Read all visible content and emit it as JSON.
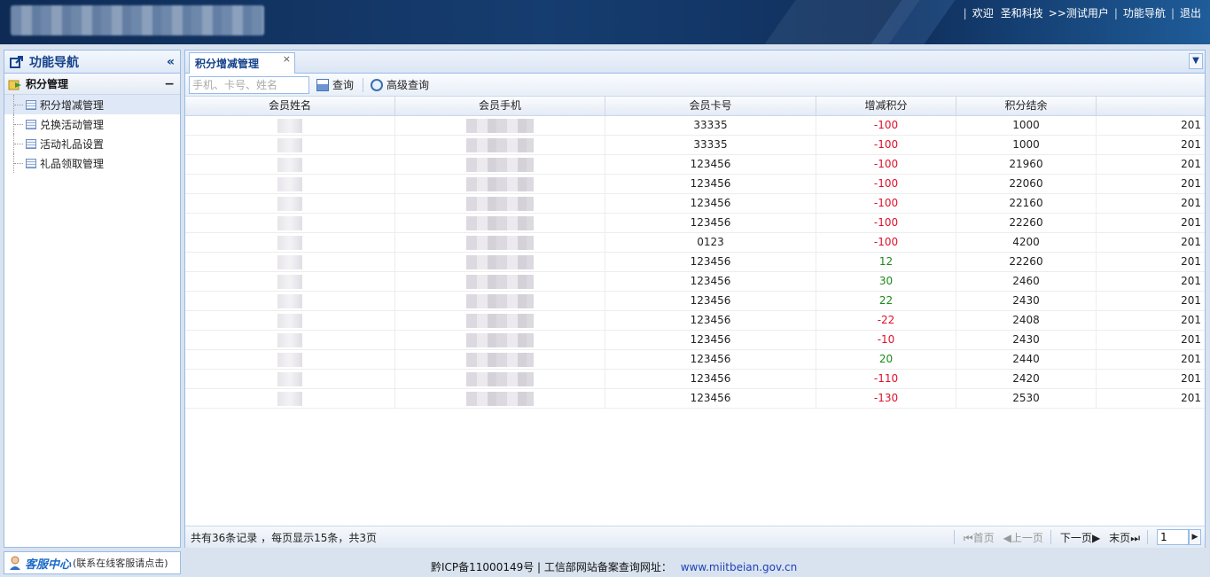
{
  "header": {
    "welcome": "欢迎",
    "company": "圣和科技",
    "user": ">>测试用户",
    "nav_link": "功能导航",
    "logout": "退出"
  },
  "sidebar": {
    "title": "功能导航",
    "group": "积分管理",
    "items": [
      {
        "label": "积分增减管理"
      },
      {
        "label": "兑换活动管理"
      },
      {
        "label": "活动礼品设置"
      },
      {
        "label": "礼品领取管理"
      }
    ]
  },
  "service": {
    "name": "客服中心",
    "hint": "(联系在线客服请点击)"
  },
  "tab": {
    "label": "积分增减管理",
    "close": "×"
  },
  "toolbar": {
    "search_placeholder": "手机、卡号、姓名",
    "query_label": "查询",
    "advanced_label": "高级查询"
  },
  "table": {
    "columns": [
      "会员姓名",
      "会员手机",
      "会员卡号",
      "增减积分",
      "积分结余",
      ""
    ],
    "rows": [
      {
        "card": "33335",
        "delta": "-100",
        "balance": "1000",
        "date": "201"
      },
      {
        "card": "33335",
        "delta": "-100",
        "balance": "1000",
        "date": "201"
      },
      {
        "card": "123456",
        "delta": "-100",
        "balance": "21960",
        "date": "201"
      },
      {
        "card": "123456",
        "delta": "-100",
        "balance": "22060",
        "date": "201"
      },
      {
        "card": "123456",
        "delta": "-100",
        "balance": "22160",
        "date": "201"
      },
      {
        "card": "123456",
        "delta": "-100",
        "balance": "22260",
        "date": "201"
      },
      {
        "card": "0123",
        "delta": "-100",
        "balance": "4200",
        "date": "201"
      },
      {
        "card": "123456",
        "delta": "12",
        "balance": "22260",
        "date": "201"
      },
      {
        "card": "123456",
        "delta": "30",
        "balance": "2460",
        "date": "201"
      },
      {
        "card": "123456",
        "delta": "22",
        "balance": "2430",
        "date": "201"
      },
      {
        "card": "123456",
        "delta": "-22",
        "balance": "2408",
        "date": "201"
      },
      {
        "card": "123456",
        "delta": "-10",
        "balance": "2430",
        "date": "201"
      },
      {
        "card": "123456",
        "delta": "20",
        "balance": "2440",
        "date": "201"
      },
      {
        "card": "123456",
        "delta": "-110",
        "balance": "2420",
        "date": "201"
      },
      {
        "card": "123456",
        "delta": "-130",
        "balance": "2530",
        "date": "201"
      }
    ]
  },
  "pager": {
    "summary": "共有36条记录 ，每页显示15条，共3页",
    "first": "首页",
    "prev": "上一页",
    "next": "下一页",
    "last": "末页",
    "page": "1"
  },
  "footer": {
    "icp": "黔ICP备11000149号 | 工信部网站备案查询网址：",
    "url": "www.miitbeian.gov.cn"
  },
  "colors": {
    "negative": "#e0102a",
    "positive": "#1a8a1a",
    "accent": "#15428b"
  }
}
